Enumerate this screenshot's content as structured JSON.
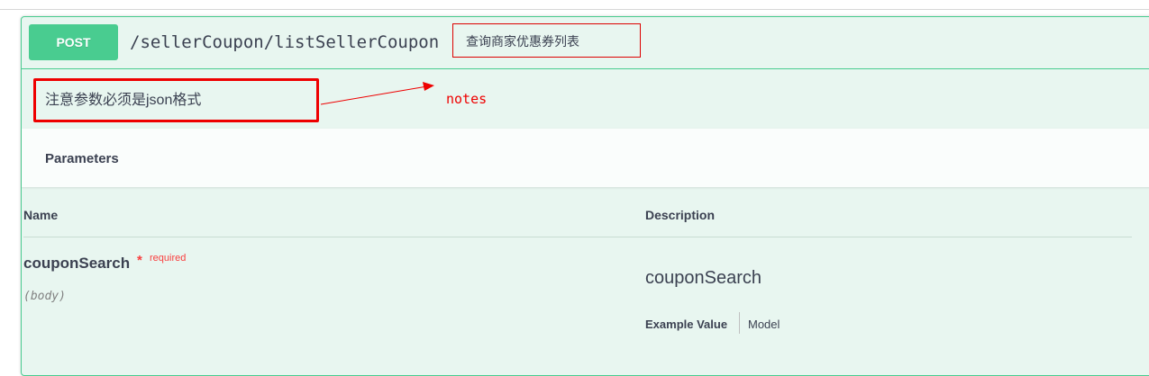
{
  "operation": {
    "method": "POST",
    "path": "/sellerCoupon/listSellerCoupon",
    "summary": "查询商家优惠券列表",
    "notes": "注意参数必须是json格式"
  },
  "annotation": {
    "label": "notes",
    "color": "#e00000"
  },
  "parameters": {
    "section_title": "Parameters",
    "columns": {
      "name": "Name",
      "description": "Description"
    },
    "items": [
      {
        "name": "couponSearch",
        "required_marker": "*",
        "required_text": "required",
        "in": "(body)",
        "description": "couponSearch",
        "tabs": {
          "example_value": "Example Value",
          "model": "Model"
        }
      }
    ]
  },
  "colors": {
    "method_post": "#49cc90",
    "block_bg": "#e8f6f0",
    "required": "#f93e3e"
  }
}
